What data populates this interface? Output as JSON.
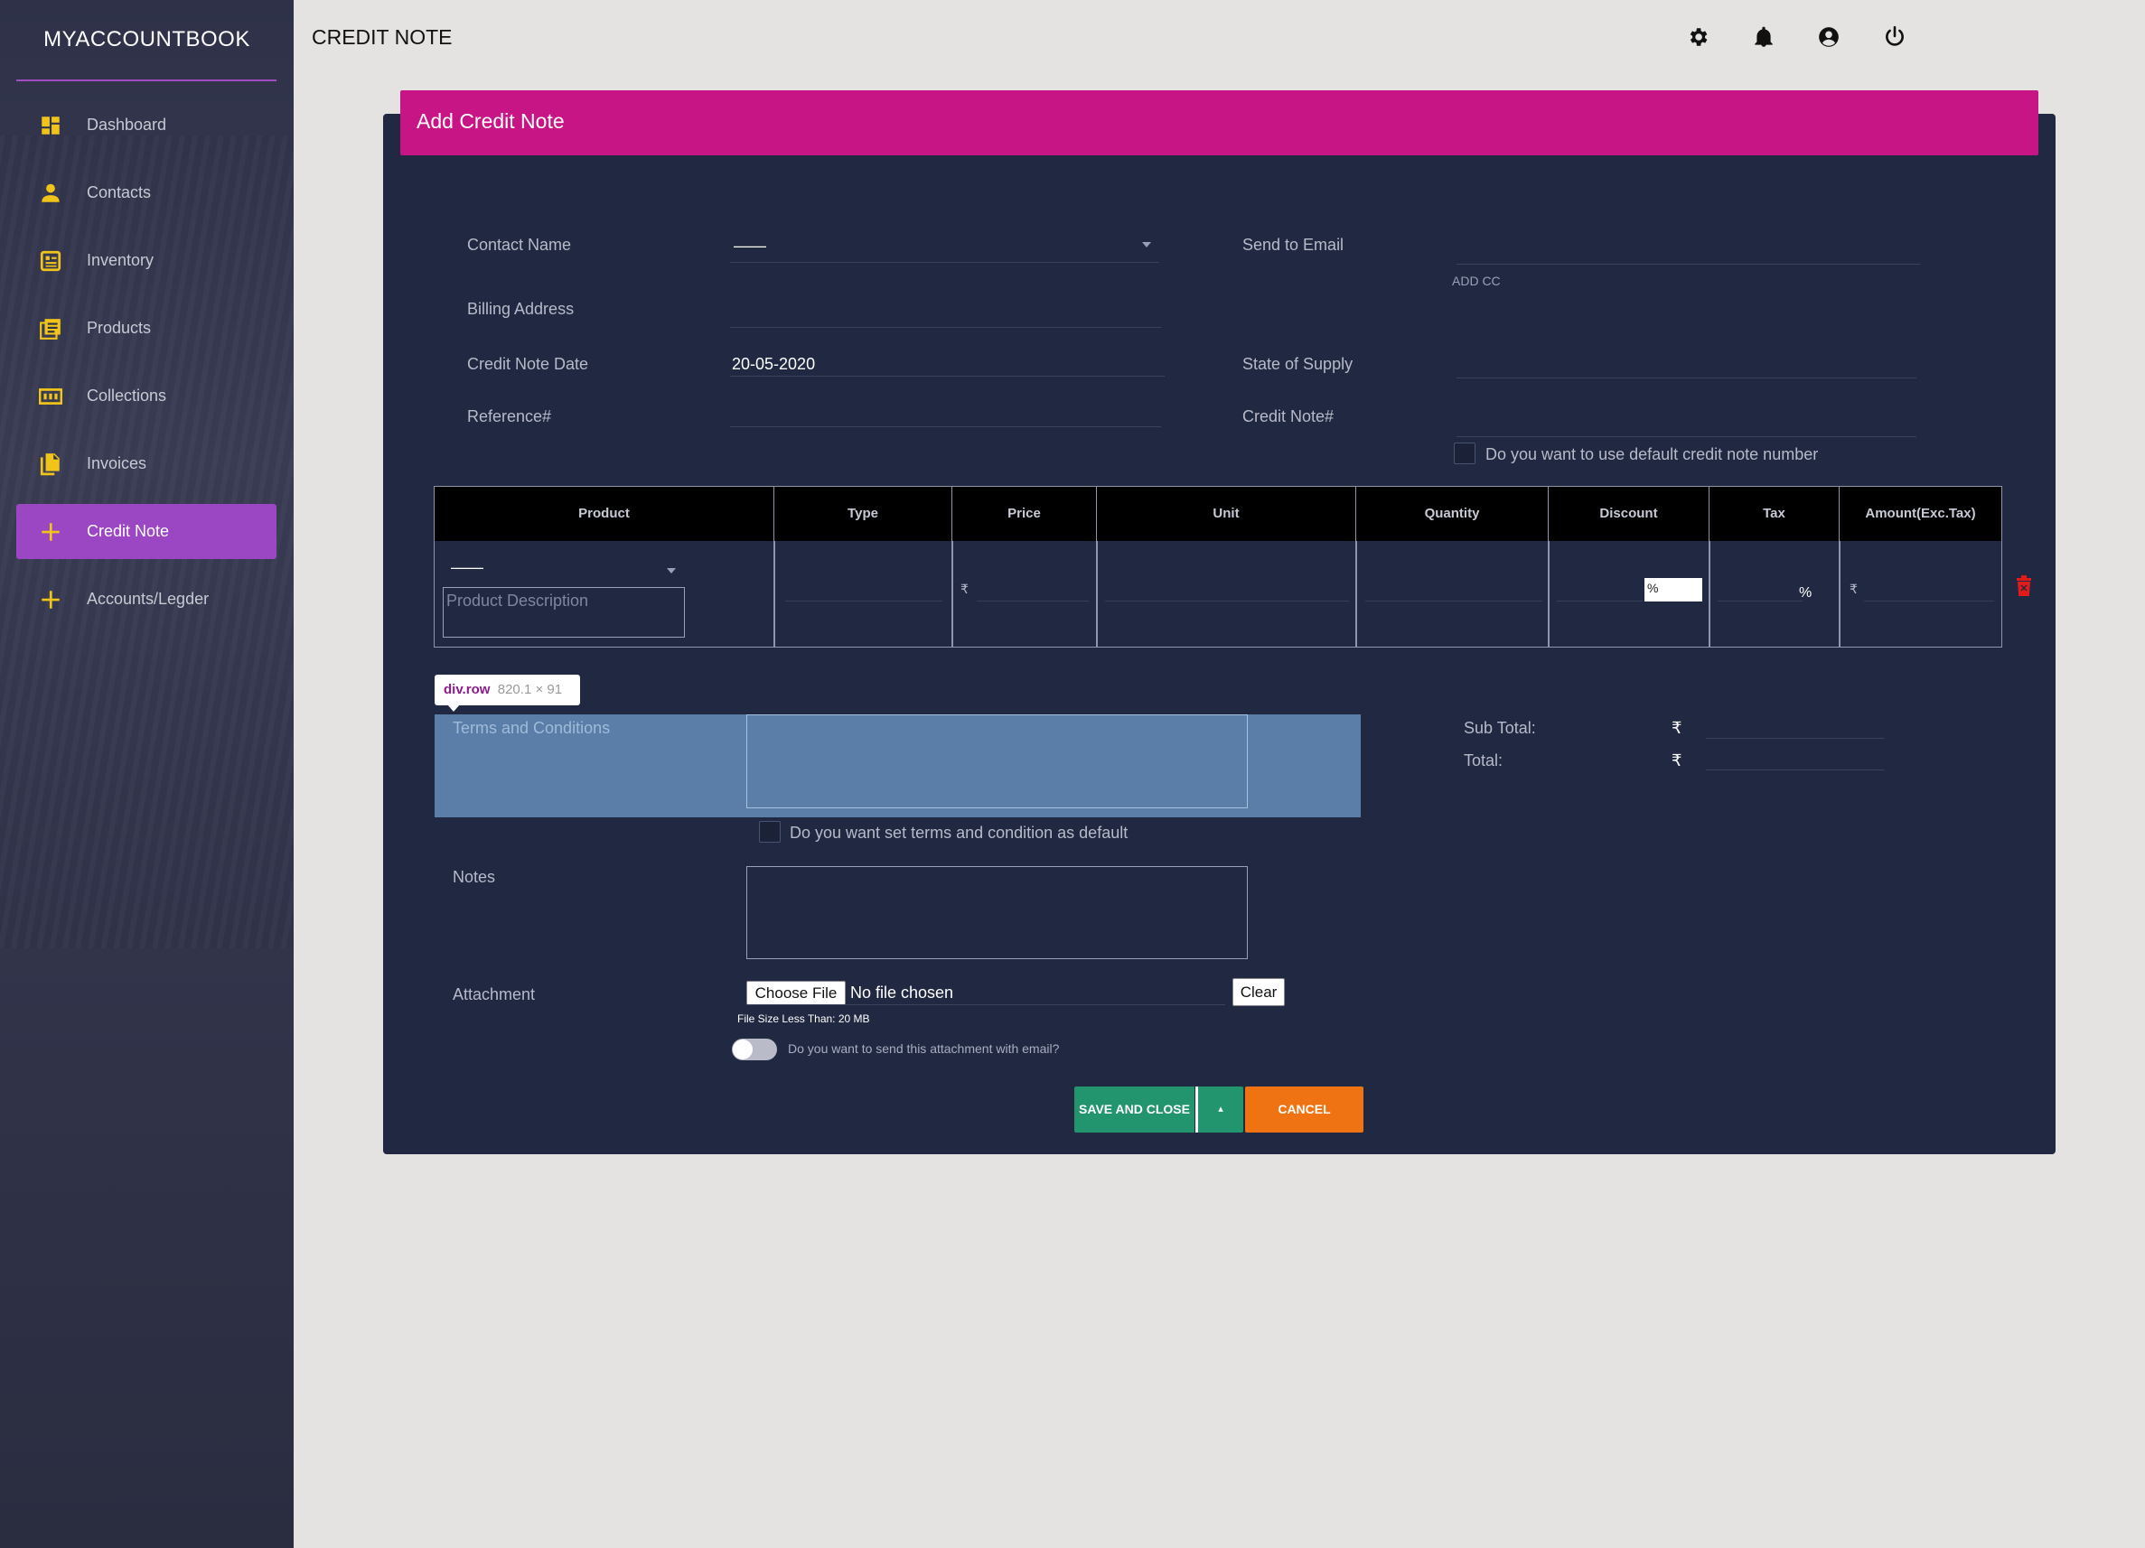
{
  "app": {
    "brand": "MYACCOUNTBOOK",
    "page_title": "CREDIT NOTE"
  },
  "sidebar": {
    "items": [
      {
        "label": "Dashboard",
        "icon": "dashboard-icon"
      },
      {
        "label": "Contacts",
        "icon": "person-icon"
      },
      {
        "label": "Inventory",
        "icon": "inventory-icon"
      },
      {
        "label": "Products",
        "icon": "products-icon"
      },
      {
        "label": "Collections",
        "icon": "collections-icon"
      },
      {
        "label": "Invoices",
        "icon": "invoices-icon"
      },
      {
        "label": "Credit Note",
        "icon": "plus-icon",
        "active": true
      },
      {
        "label": "Accounts/Legder",
        "icon": "plus-icon"
      }
    ]
  },
  "header_icons": [
    "settings-icon",
    "bell-icon",
    "account-icon",
    "power-icon"
  ],
  "form": {
    "heading": "Add Credit Note",
    "contact_name_label": "Contact Name",
    "contact_name_value": "——",
    "send_to_email_label": "Send to Email",
    "add_cc": "ADD CC",
    "billing_address_label": "Billing Address",
    "credit_note_date_label": "Credit Note Date",
    "credit_note_date_value": "20-05-2020",
    "state_of_supply_label": "State of Supply",
    "reference_label": "Reference#",
    "credit_note_no_label": "Credit Note#",
    "default_number_label": "Do you want to use default credit note number"
  },
  "table": {
    "headers": [
      "Product",
      "Type",
      "Price",
      "Unit",
      "Quantity",
      "Discount",
      "Tax",
      "Amount(Exc.Tax)"
    ],
    "row": {
      "product_value": "——",
      "description_placeholder": "Product Description",
      "price_currency": "₹",
      "discount_unit": "%",
      "tax_unit": "%",
      "amount_currency": "₹"
    }
  },
  "tooltip": {
    "tag": "div.row",
    "size": "820.1 × 91"
  },
  "terms": {
    "label": "Terms and Conditions",
    "default_label": "Do you want set terms and condition as default"
  },
  "totals": {
    "sub_total_label": "Sub Total:",
    "total_label": "Total:",
    "currency": "₹"
  },
  "notes": {
    "label": "Notes"
  },
  "attachment": {
    "label": "Attachment",
    "choose_button": "Choose File",
    "status": "No file chosen",
    "clear_button": "Clear",
    "size_note": "File Size Less Than: 20 MB",
    "send_with_email_label": "Do you want to send this attachment with email?"
  },
  "actions": {
    "save_close": "SAVE AND CLOSE",
    "caret": "▴",
    "cancel": "CANCEL"
  },
  "colors": {
    "accent": "#c71585",
    "sidebar_active": "#9b46c3",
    "save": "#23956e",
    "cancel": "#f07313",
    "card": "#212841"
  }
}
